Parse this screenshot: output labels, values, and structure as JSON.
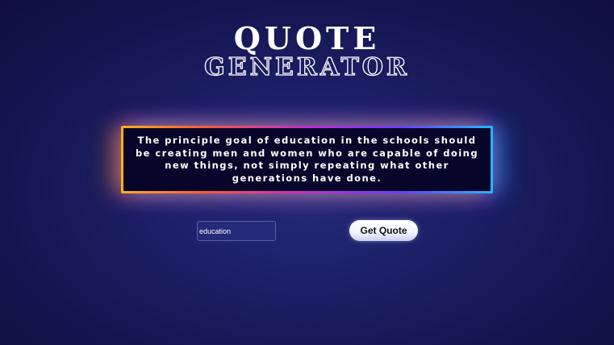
{
  "title": {
    "line1": "QUOTE",
    "line2": "GENERATOR"
  },
  "quote": {
    "text": "The principle goal of education in the schools should be creating men and women who are capable of doing new things, not simply repeating what other generations have done."
  },
  "search": {
    "value": "education",
    "placeholder": ""
  },
  "button": {
    "label": "Get Quote"
  },
  "colors": {
    "background": "#1d2068",
    "border_gradient_start": "#ffb020",
    "border_gradient_mid": "#c12ccf",
    "border_gradient_end": "#21b8ff",
    "quote_box_bg": "#07062a"
  }
}
